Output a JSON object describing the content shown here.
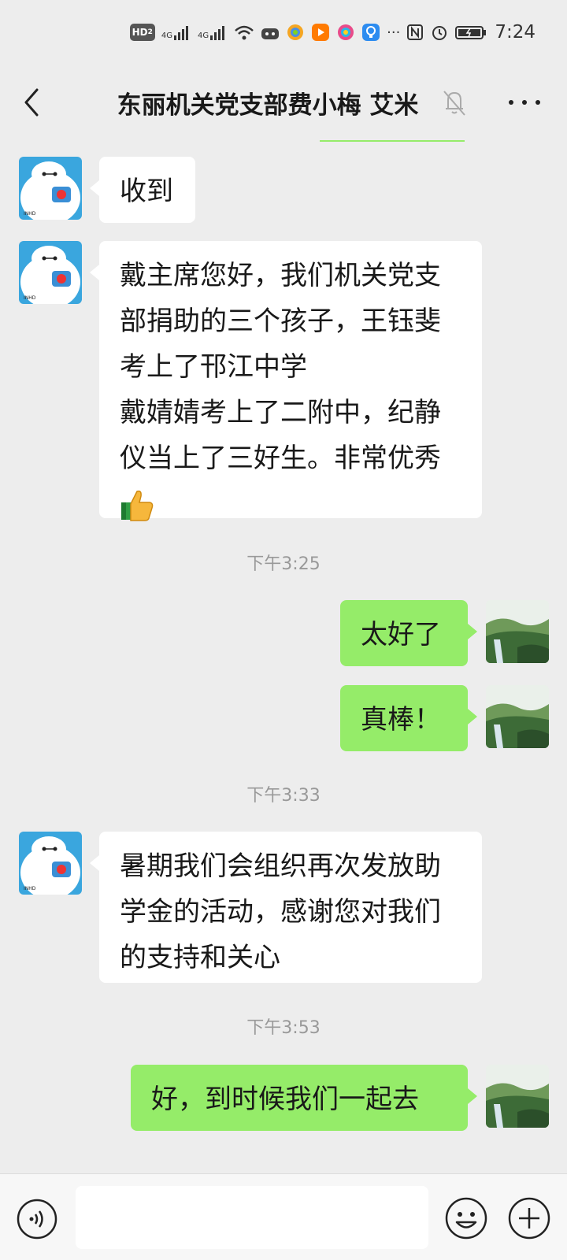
{
  "status_bar": {
    "hd_label": "HD",
    "hd_sub": "2",
    "signal1_label": "4G",
    "signal2_label": "4G",
    "more_label": "···",
    "time": "7:24"
  },
  "header": {
    "title": "东丽机关党支部费小梅 艾米",
    "back_icon": "chevron-left-icon",
    "mute_icon": "bell-off-icon",
    "more_icon": "more-dots-icon"
  },
  "messages": [
    {
      "side": "left",
      "text": "收到"
    },
    {
      "side": "left",
      "text": "戴主席您好，我们机关党支部捐助的三个孩子，王钰斐考上了邗江中学\n戴婧婧考上了二附中，纪静仪当上了三好生。非常优秀",
      "emoji": "thumbs-up"
    },
    {
      "side": "time",
      "text": "下午3:25"
    },
    {
      "side": "right",
      "text": "太好了"
    },
    {
      "side": "right",
      "text": "真棒！"
    },
    {
      "side": "time",
      "text": "下午3:33"
    },
    {
      "side": "left",
      "text": "暑期我们会组织再次发放助学金的活动，感谢您对我们的支持和关心"
    },
    {
      "side": "time",
      "text": "下午3:53"
    },
    {
      "side": "right",
      "text": "好，到时候我们一起去"
    }
  ],
  "input_bar": {
    "value": "",
    "voice_icon": "voice-icon",
    "emoji_icon": "emoji-icon",
    "plus_icon": "plus-icon"
  },
  "colors": {
    "background": "#ededed",
    "bubble_self": "#95ec69",
    "bubble_other": "#ffffff"
  }
}
